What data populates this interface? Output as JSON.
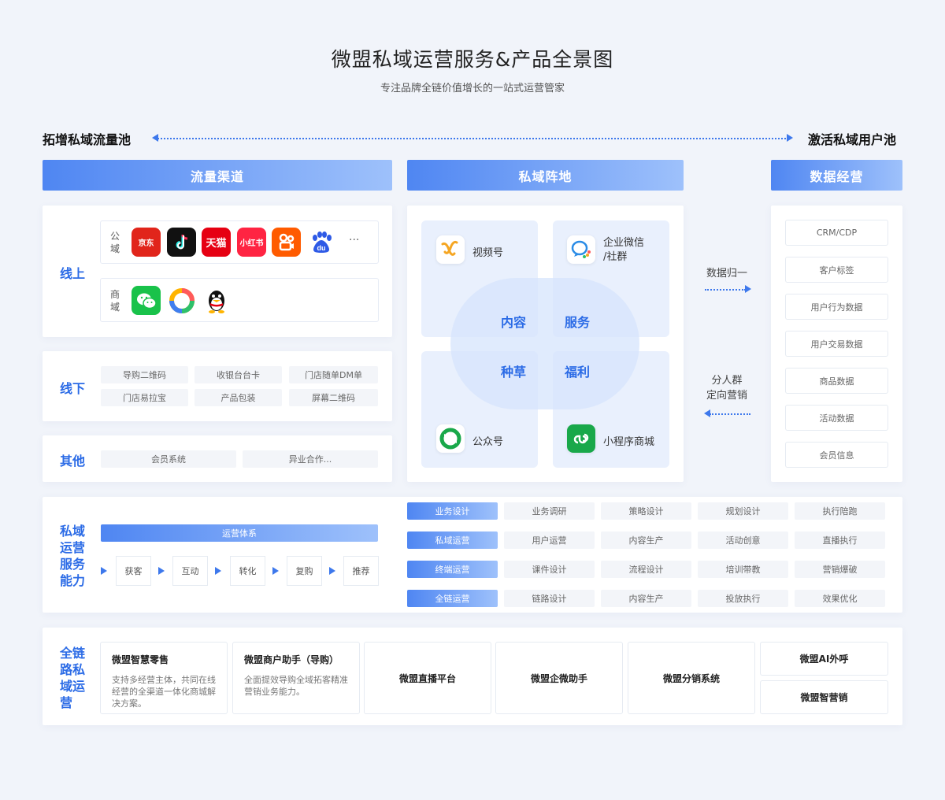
{
  "header": {
    "title": "微盟私域运营服务&产品全景图",
    "subtitle": "专注品牌全链价值增长的一站式运营管家"
  },
  "pools": {
    "left": "拓增私域流量池",
    "right": "激活私域用户池"
  },
  "columns": {
    "traffic": "流量渠道",
    "private": "私域阵地",
    "data": "数据经营"
  },
  "traffic": {
    "online_label": "线上",
    "public_domain_label": "公域",
    "commerce_domain_label": "商域",
    "public_apps": [
      {
        "name": "京东",
        "color": "#e1251b"
      },
      {
        "name": "抖音",
        "color": "#111111"
      },
      {
        "name": "天猫",
        "color": "#e60012"
      },
      {
        "name": "小红书",
        "color": "#ff2442"
      },
      {
        "name": "快手",
        "color": "#ff5b00"
      },
      {
        "name": "du",
        "color": "#2e5ae6"
      }
    ],
    "more": "···",
    "offline_label": "线下",
    "offline_tags": [
      "导购二维码",
      "收银台台卡",
      "门店随单DM单",
      "门店易拉宝",
      "产品包装",
      "屏幕二维码"
    ],
    "other_label": "其他",
    "other_tags": [
      "会员系统",
      "异业合作..."
    ]
  },
  "private": {
    "video": "视频号",
    "wecom_line1": "企业微信",
    "wecom_line2": "/社群",
    "official": "公众号",
    "miniapp": "小程序商城",
    "content": "内容",
    "service": "服务",
    "seeding": "种草",
    "welfare": "福利"
  },
  "flow": {
    "unify": "数据归一",
    "group_line1": "分人群",
    "group_line2": "定向营销"
  },
  "data_items": [
    "CRM/CDP",
    "客户标签",
    "用户行为数据",
    "用户交易数据",
    "商品数据",
    "活动数据",
    "会员信息"
  ],
  "ops": {
    "label": [
      "私域",
      "运营",
      "服务",
      "能力"
    ],
    "system": "运营体系",
    "steps": [
      "获客",
      "互动",
      "转化",
      "复购",
      "推荐"
    ],
    "rows": [
      {
        "head": "业务设计",
        "items": [
          "业务调研",
          "策略设计",
          "规划设计",
          "执行陪跑"
        ]
      },
      {
        "head": "私域运营",
        "items": [
          "用户运营",
          "内容生产",
          "活动创意",
          "直播执行"
        ]
      },
      {
        "head": "终端运营",
        "items": [
          "课件设计",
          "流程设计",
          "培训带教",
          "营销爆破"
        ]
      },
      {
        "head": "全链运营",
        "items": [
          "链路设计",
          "内容生产",
          "投放执行",
          "效果优化"
        ]
      }
    ]
  },
  "products": {
    "label": [
      "全链",
      "路私",
      "域运",
      "营"
    ],
    "retail_name": "微盟智慧零售",
    "retail_desc": "支持多经营主体，共同在线经营的全渠道一体化商城解决方案。",
    "assistant_name": "微盟商户助手（导购）",
    "assistant_desc": "全面提效导购全域拓客精准营销业务能力。",
    "live": "微盟直播平台",
    "wecom_helper": "微盟企微助手",
    "distribution": "微盟分销系统",
    "ai_call": "微盟AI外呼",
    "smart_marketing": "微盟智营销"
  }
}
